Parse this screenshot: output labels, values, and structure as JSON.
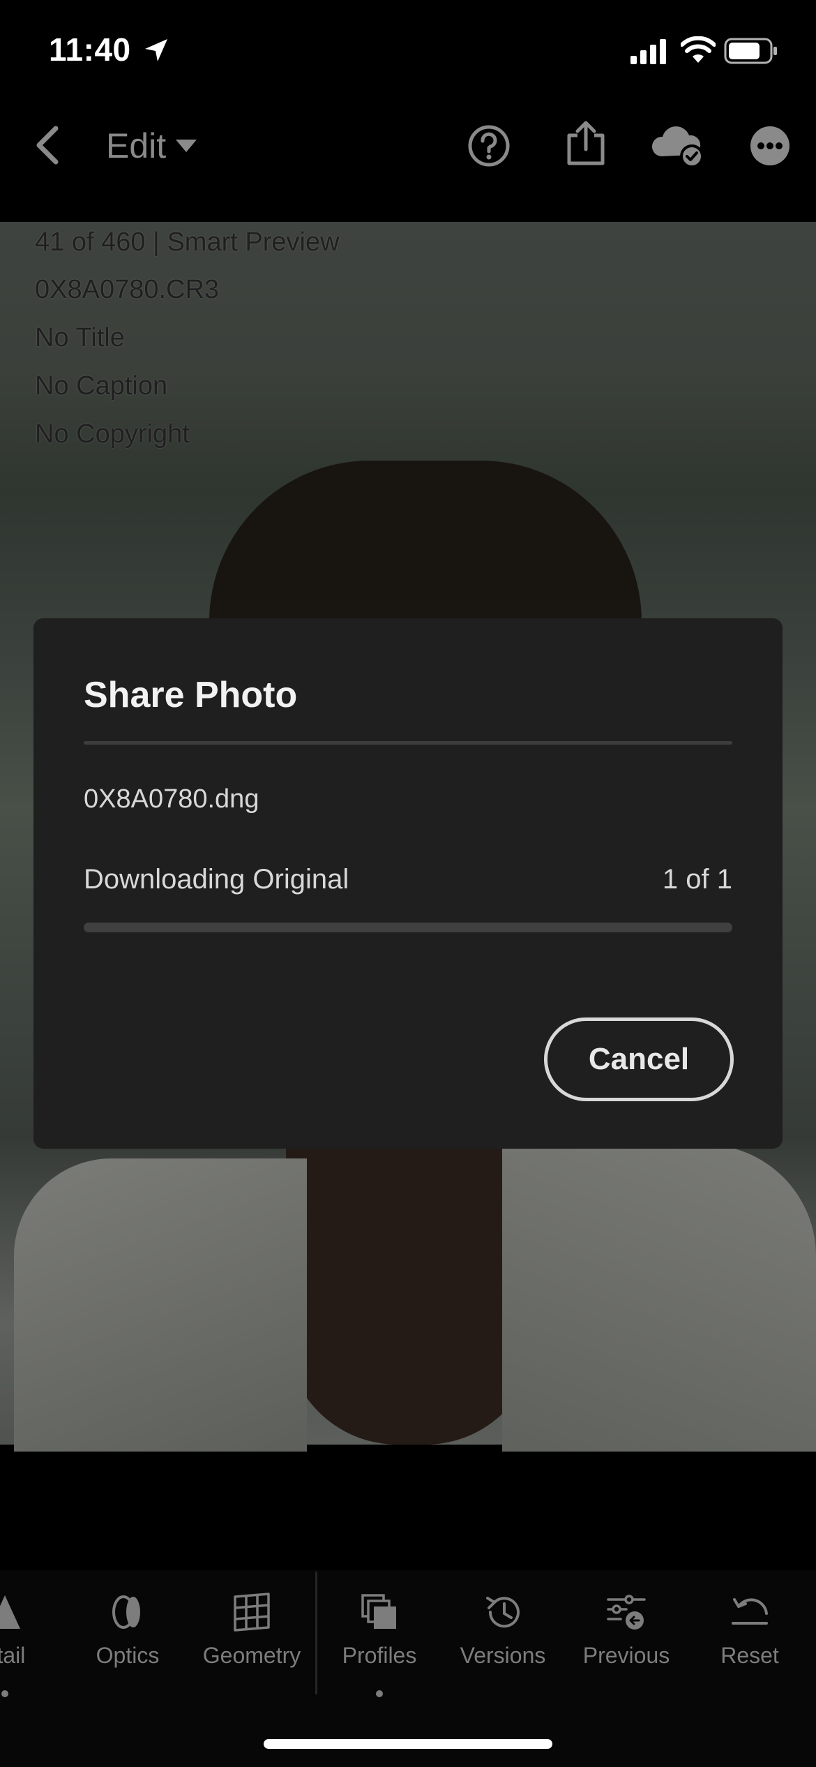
{
  "status_bar": {
    "time": "11:40"
  },
  "app_bar": {
    "title": "Edit",
    "icons": [
      "back-chevron-icon",
      "dropdown-caret-icon",
      "help-icon",
      "share-icon",
      "cloud-synced-icon",
      "more-icon"
    ]
  },
  "photo_info": {
    "position_text": "41 of 460 | Smart Preview",
    "filename": "0X8A0780.CR3",
    "title": "No Title",
    "caption": "No Caption",
    "copyright": "No Copyright"
  },
  "dialog": {
    "title": "Share Photo",
    "file_name": "0X8A0780.dng",
    "status_text": "Downloading Original",
    "count_text": "1 of 1",
    "progress": 0,
    "cancel_label": "Cancel"
  },
  "toolbar": {
    "items": [
      {
        "label": "etail",
        "icon": "detail-icon"
      },
      {
        "label": "Optics",
        "icon": "optics-icon"
      },
      {
        "label": "Geometry",
        "icon": "geometry-icon"
      },
      {
        "label": "Profiles",
        "icon": "profiles-icon"
      },
      {
        "label": "Versions",
        "icon": "versions-icon"
      },
      {
        "label": "Previous",
        "icon": "previous-icon"
      },
      {
        "label": "Reset",
        "icon": "reset-icon"
      }
    ]
  }
}
